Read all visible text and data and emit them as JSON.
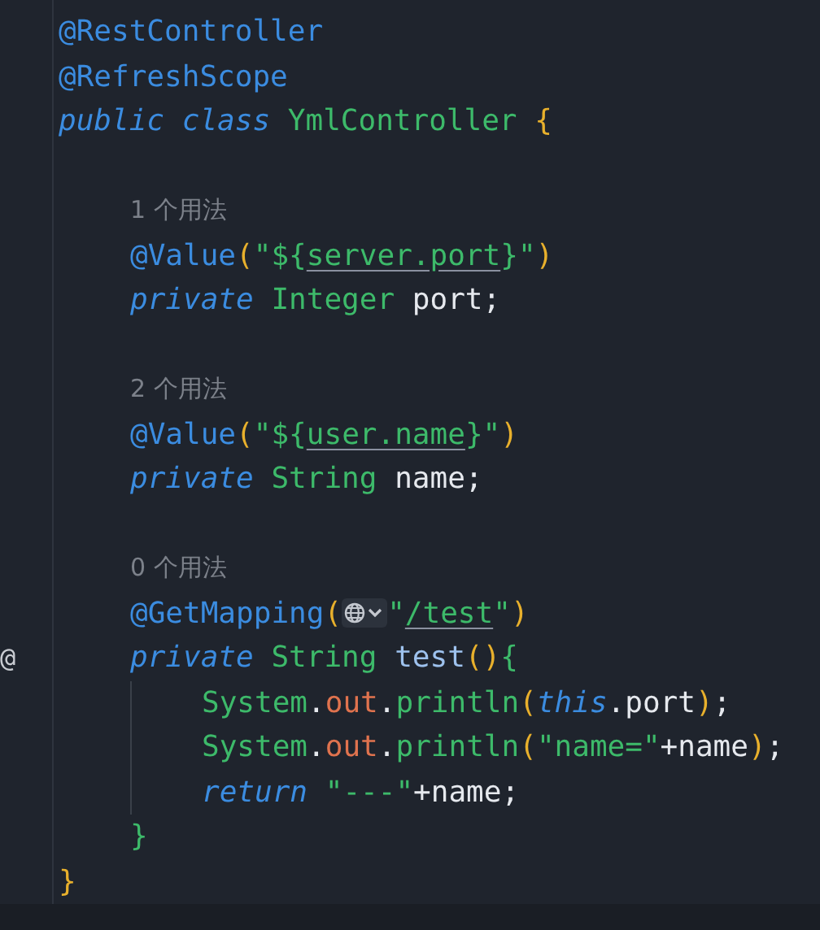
{
  "editor": {
    "lines": [
      {
        "kind": "code",
        "tokens": [
          {
            "kind": "anno",
            "text": "@RestController"
          }
        ]
      },
      {
        "kind": "code",
        "tokens": [
          {
            "kind": "anno",
            "text": "@RefreshScope"
          }
        ]
      },
      {
        "kind": "code",
        "tokens": [
          {
            "kind": "kw",
            "text": "public "
          },
          {
            "kind": "kw",
            "text": "class "
          },
          {
            "kind": "type",
            "text": "YmlController "
          },
          {
            "kind": "paren",
            "text": "{"
          }
        ],
        "children": [
          {
            "kind": "blank"
          },
          {
            "kind": "hint",
            "tokens": [
              {
                "kind": "hint",
                "text": "1 个用法"
              }
            ]
          },
          {
            "kind": "code",
            "tokens": [
              {
                "kind": "anno",
                "text": "@Value"
              },
              {
                "kind": "paren",
                "text": "("
              },
              {
                "kind": "str",
                "text": "\"${"
              },
              {
                "kind": "ref",
                "text": "server.port"
              },
              {
                "kind": "str",
                "text": "}\""
              },
              {
                "kind": "paren",
                "text": ")"
              }
            ]
          },
          {
            "kind": "code",
            "tokens": [
              {
                "kind": "kw",
                "text": "private "
              },
              {
                "kind": "type",
                "text": "Integer"
              },
              {
                "kind": "punct",
                "text": " port;"
              }
            ]
          },
          {
            "kind": "blank"
          },
          {
            "kind": "hint",
            "tokens": [
              {
                "kind": "hint",
                "text": "2 个用法"
              }
            ]
          },
          {
            "kind": "code",
            "tokens": [
              {
                "kind": "anno",
                "text": "@Value"
              },
              {
                "kind": "paren",
                "text": "("
              },
              {
                "kind": "str",
                "text": "\"${"
              },
              {
                "kind": "ref",
                "text": "user.name"
              },
              {
                "kind": "str",
                "text": "}\""
              },
              {
                "kind": "paren",
                "text": ")"
              }
            ]
          },
          {
            "kind": "code",
            "tokens": [
              {
                "kind": "kw",
                "text": "private "
              },
              {
                "kind": "type",
                "text": "String"
              },
              {
                "kind": "punct",
                "text": " name;"
              }
            ]
          },
          {
            "kind": "blank"
          },
          {
            "kind": "hint",
            "tokens": [
              {
                "kind": "hint",
                "text": "0 个用法"
              }
            ]
          },
          {
            "kind": "code",
            "tokens": [
              {
                "kind": "anno",
                "text": "@GetMapping"
              },
              {
                "kind": "paren",
                "text": "("
              },
              {
                "kind": "url-icon"
              },
              {
                "kind": "str",
                "text": "\""
              },
              {
                "kind": "ref",
                "text": "/test"
              },
              {
                "kind": "str",
                "text": "\""
              },
              {
                "kind": "paren",
                "text": ")"
              }
            ]
          },
          {
            "kind": "code",
            "gutter": "@",
            "tokens": [
              {
                "kind": "kw",
                "text": "private "
              },
              {
                "kind": "type",
                "text": "String "
              },
              {
                "kind": "decl",
                "text": "test"
              },
              {
                "kind": "paren",
                "text": "()"
              },
              {
                "kind": "block",
                "text": "{"
              }
            ],
            "children": [
              {
                "kind": "code",
                "tokens": [
                  {
                    "kind": "type",
                    "text": "System"
                  },
                  {
                    "kind": "punct",
                    "text": "."
                  },
                  {
                    "kind": "field",
                    "text": "out"
                  },
                  {
                    "kind": "punct",
                    "text": "."
                  },
                  {
                    "kind": "method",
                    "text": "println"
                  },
                  {
                    "kind": "paren",
                    "text": "("
                  },
                  {
                    "kind": "kw",
                    "text": "this"
                  },
                  {
                    "kind": "punct",
                    "text": ".port"
                  },
                  {
                    "kind": "paren",
                    "text": ")"
                  },
                  {
                    "kind": "punct",
                    "text": ";"
                  }
                ]
              },
              {
                "kind": "code",
                "tokens": [
                  {
                    "kind": "type",
                    "text": "System"
                  },
                  {
                    "kind": "punct",
                    "text": "."
                  },
                  {
                    "kind": "field",
                    "text": "out"
                  },
                  {
                    "kind": "punct",
                    "text": "."
                  },
                  {
                    "kind": "method",
                    "text": "println"
                  },
                  {
                    "kind": "paren",
                    "text": "("
                  },
                  {
                    "kind": "str",
                    "text": "\"name=\""
                  },
                  {
                    "kind": "punct",
                    "text": "+name"
                  },
                  {
                    "kind": "paren",
                    "text": ")"
                  },
                  {
                    "kind": "punct",
                    "text": ";"
                  }
                ]
              },
              {
                "kind": "code",
                "tokens": [
                  {
                    "kind": "kw",
                    "text": "return "
                  },
                  {
                    "kind": "str",
                    "text": "\"---\""
                  },
                  {
                    "kind": "punct",
                    "text": "+name;"
                  }
                ]
              }
            ]
          },
          {
            "kind": "code",
            "tokens": [
              {
                "kind": "block",
                "text": "}"
              }
            ]
          }
        ]
      },
      {
        "kind": "code",
        "tokens": [
          {
            "kind": "paren",
            "text": "}"
          }
        ]
      }
    ]
  }
}
